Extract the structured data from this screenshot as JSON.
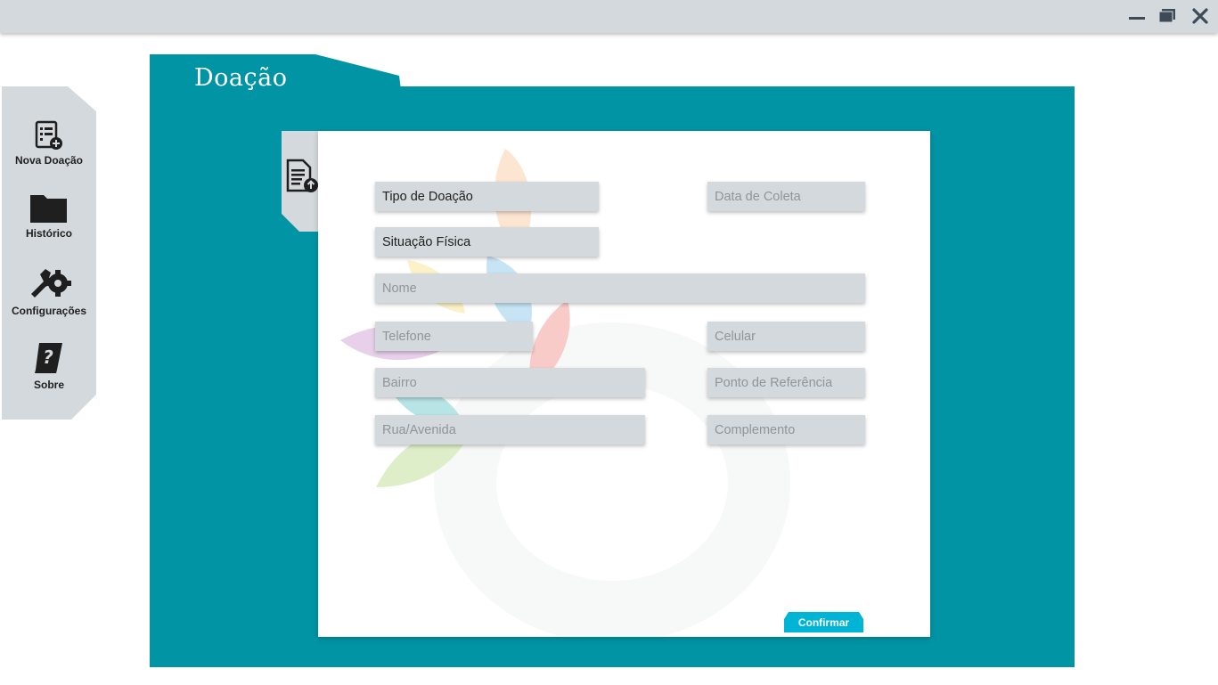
{
  "window": {
    "controls": {
      "minimize": "minimize-icon",
      "maximize": "maximize-icon",
      "close": "close-icon"
    }
  },
  "sidebar": {
    "items": [
      {
        "label": "Nova Doação",
        "icon": "new-document-icon"
      },
      {
        "label": "Histórico",
        "icon": "folder-icon"
      },
      {
        "label": "Configurações",
        "icon": "settings-tools-icon"
      },
      {
        "label": "Sobre",
        "icon": "help-book-icon"
      }
    ]
  },
  "page": {
    "title": "Doação",
    "form_tab_icon": "document-upload-icon"
  },
  "form": {
    "tipo_doacao": {
      "value": "Tipo de Doação"
    },
    "data_coleta": {
      "placeholder": "Data de Coleta"
    },
    "situacao_fisica": {
      "value": "Situação Física"
    },
    "nome": {
      "placeholder": "Nome"
    },
    "telefone": {
      "placeholder": "Telefone"
    },
    "celular": {
      "placeholder": "Celular"
    },
    "bairro": {
      "placeholder": "Bairro"
    },
    "ponto_referencia": {
      "placeholder": "Ponto de Referência"
    },
    "rua_avenida": {
      "placeholder": "Rua/Avenida"
    },
    "complemento": {
      "placeholder": "Complemento"
    },
    "confirm_label": "Confirmar"
  },
  "colors": {
    "panel": "#0094a4",
    "chrome": "#d3d9dc",
    "confirm": "#00b4d6"
  }
}
